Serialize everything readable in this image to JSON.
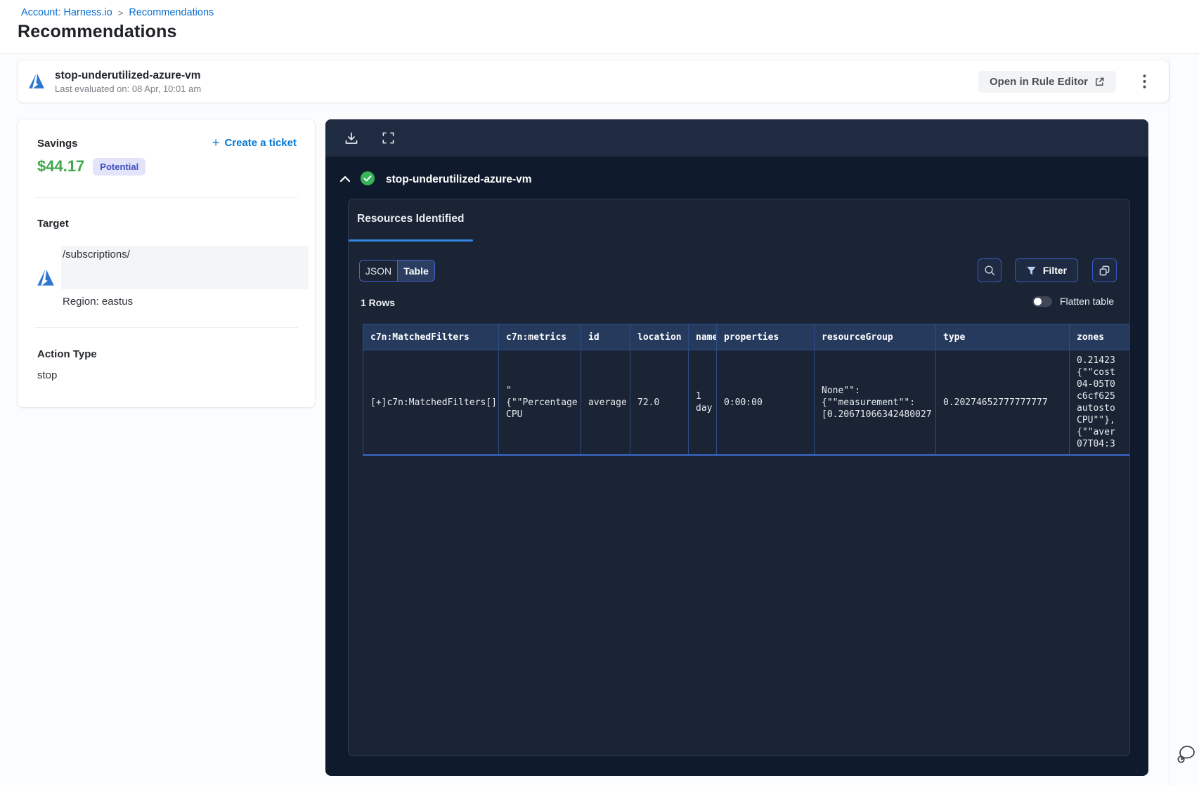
{
  "breadcrumb": {
    "account": "Account: Harness.io",
    "separator": ">",
    "current": "Recommendations"
  },
  "page": {
    "title": "Recommendations"
  },
  "header_card": {
    "rule_name": "stop-underutilized-azure-vm",
    "last_evaluated": "Last evaluated on: 08 Apr, 10:01 am",
    "open_button": "Open in Rule Editor"
  },
  "details_card": {
    "savings_label": "Savings",
    "savings_amount": "$44.17",
    "savings_badge": "Potential",
    "create_ticket_label": "Create a ticket",
    "target_label": "Target",
    "target_path": "/subscriptions/",
    "region": "Region: eastus",
    "action_type_label": "Action Type",
    "action_type_value": "stop"
  },
  "results_panel": {
    "title": "stop-underutilized-azure-vm",
    "tab": "Resources Identified",
    "view_toggle": {
      "json_label": "JSON",
      "table_label": "Table",
      "selected": "Table"
    },
    "filter_label": "Filter",
    "rows_count": "1 Rows",
    "flatten_label": "Flatten table",
    "flatten_state": "off",
    "table": {
      "columns": [
        "c7n:MatchedFilters",
        "c7n:metrics",
        "id",
        "location",
        "name",
        "properties",
        "resourceGroup",
        "type",
        "zones"
      ],
      "rows": [
        {
          "cells": [
            "[+]c7n:MatchedFilters[]",
            "\"\n{\"\"Percentage\nCPU",
            "average",
            "72.0",
            "1\nday",
            "0:00:00",
            "None\"\":\n{\"\"measurement\"\":\n[0.20671066342480027",
            "0.20274652777777777",
            "0.21423\n{\"\"cost\n04-05T0\nc6cf625\nautosto\nCPU\"\"},\n{\"\"aver\n07T04:3"
          ]
        }
      ]
    }
  },
  "icons": [
    "azure-icon",
    "external-link-icon",
    "more-menu-icon",
    "plus-icon",
    "download-icon",
    "fullscreen-icon",
    "collapse-icon",
    "success-check-icon",
    "search-icon",
    "filter-icon",
    "copy-icon",
    "toggle-off",
    "chat-support-icon"
  ],
  "colors": {
    "breadcrumb_link": "#0a6fce",
    "create_ticket_blue": "#0278d5",
    "savings_green": "#3fa84c",
    "badge_bg": "#e3e4fb",
    "badge_text": "#4050bd",
    "panel_toolbar": "#1f2b40",
    "panel_body": "#0f1b2c",
    "inner_panel_bg": "#1a2434",
    "table_header_bg": "#263a5e",
    "table_border": "#2d4d85",
    "row_bottom_border": "#3a6ace",
    "tab_underline": "#3385e4",
    "button_border_blue": "#3a56bd",
    "cell_link_blue": "#6db4dd",
    "check_green": "#35b558",
    "azure_blue": "#2e76cf"
  }
}
